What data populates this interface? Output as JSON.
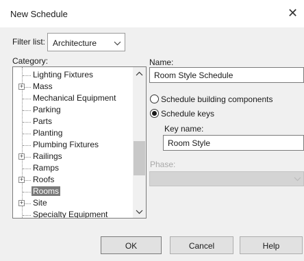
{
  "window": {
    "title": "New Schedule",
    "close_glyph": "✕"
  },
  "filter": {
    "label": "Filter list:",
    "value": "Architecture"
  },
  "category": {
    "label": "Category:",
    "items": [
      {
        "label": "Lighting Fixtures",
        "expandable": false,
        "selected": false
      },
      {
        "label": "Mass",
        "expandable": true,
        "selected": false
      },
      {
        "label": "Mechanical Equipment",
        "expandable": false,
        "selected": false
      },
      {
        "label": "Parking",
        "expandable": false,
        "selected": false
      },
      {
        "label": "Parts",
        "expandable": false,
        "selected": false
      },
      {
        "label": "Planting",
        "expandable": false,
        "selected": false
      },
      {
        "label": "Plumbing Fixtures",
        "expandable": false,
        "selected": false
      },
      {
        "label": "Railings",
        "expandable": true,
        "selected": false
      },
      {
        "label": "Ramps",
        "expandable": false,
        "selected": false
      },
      {
        "label": "Roofs",
        "expandable": true,
        "selected": false
      },
      {
        "label": "Rooms",
        "expandable": false,
        "selected": true
      },
      {
        "label": "Site",
        "expandable": true,
        "selected": false
      },
      {
        "label": "Specialty Equipment",
        "expandable": false,
        "selected": false
      }
    ]
  },
  "name": {
    "label": "Name:",
    "value": "Room Style Schedule"
  },
  "options": {
    "building_components": "Schedule building components",
    "keys": "Schedule keys",
    "selected": "keys"
  },
  "key_name": {
    "label": "Key name:",
    "value": "Room Style"
  },
  "phase": {
    "label": "Phase:",
    "value": ""
  },
  "buttons": {
    "ok": "OK",
    "cancel": "Cancel",
    "help": "Help"
  },
  "colors": {
    "selection": "#7a7a7a",
    "background": "#f0f0f0"
  }
}
